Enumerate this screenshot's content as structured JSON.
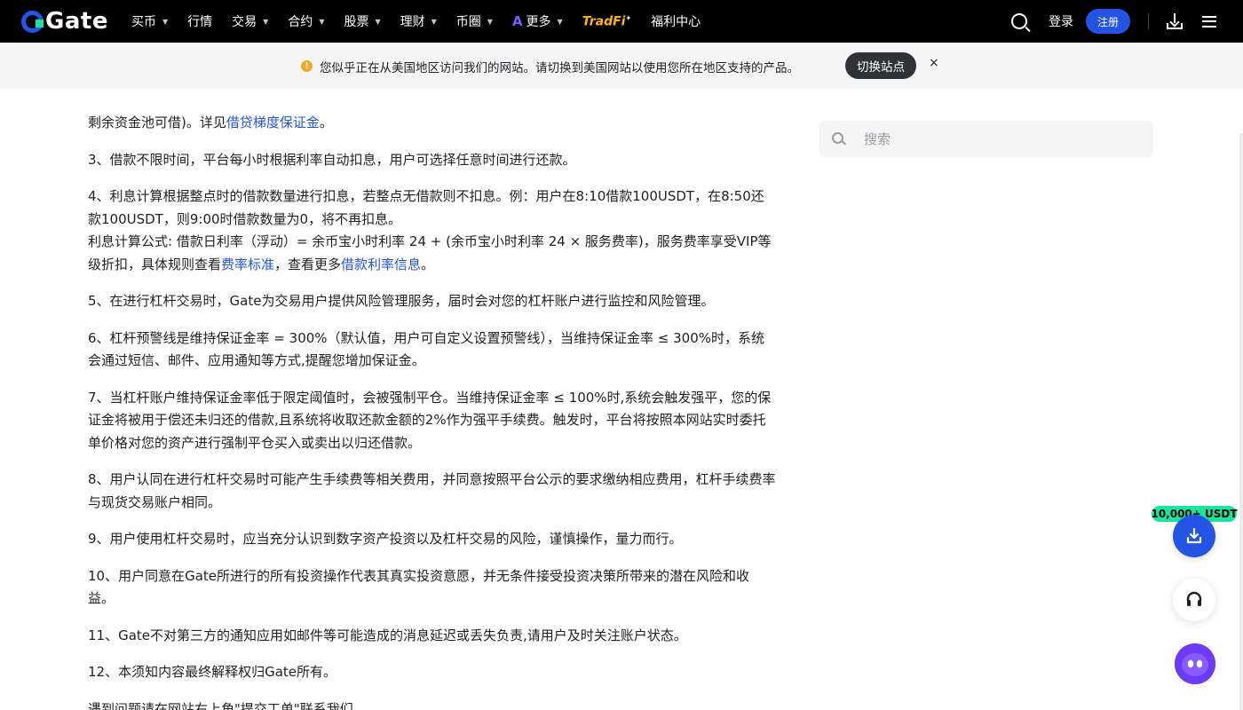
{
  "header": {
    "logo_text": "Gate",
    "nav": [
      {
        "label": "买币",
        "has_caret": true
      },
      {
        "label": "行情",
        "has_caret": false
      },
      {
        "label": "交易",
        "has_caret": true
      },
      {
        "label": "合约",
        "has_caret": true
      },
      {
        "label": "股票",
        "has_caret": true
      },
      {
        "label": "理财",
        "has_caret": true
      },
      {
        "label": "币圈",
        "has_caret": true
      }
    ],
    "more_label": "更多",
    "tradfi_label": "TradFi",
    "welfare_label": "福利中心",
    "login_label": "登录",
    "signup_label": "注册"
  },
  "notice": {
    "message": "您似乎正在从美国地区访问我们的网站。请切换到美国网站以使用您所在地区支持的产品。",
    "switch_label": "切换站点",
    "close_symbol": "×"
  },
  "article": {
    "item2_tail_text": "剩余资金池可借)。详见",
    "item2_link": "借贷梯度保证金",
    "item2_end": "。",
    "item3": "3、借款不限时间，平台每小时根据利率自动扣息，用户可选择任意时间进行还款。",
    "item4_line1": "4、利息计算根据整点时的借款数量进行扣息，若整点无借款则不扣息。例：用户在8:10借款100USDT，在8:50还款100USDT，则9:00时借款数量为0，将不再扣息。",
    "item4_formula": "利息计算公式: 借款日利率（浮动）= 余币宝小时利率 24 + (余币宝小时利率 24 × 服务费率)，服务费率享受VIP等级折扣，具体规则查看",
    "item4_link1": "费率标准",
    "item4_mid": "，查看更多",
    "item4_link2": "借款利率信息",
    "item4_end": "。",
    "item5": "5、在进行杠杆交易时，Gate为交易用户提供风险管理服务，届时会对您的杠杆账户进行监控和风险管理。",
    "item6": "6、杠杆预警线是维持保证金率 = 300%（默认值，用户可自定义设置预警线），当维持保证金率 ≤ 300%时，系统会通过短信、邮件、应用通知等方式,提醒您增加保证金。",
    "item7": "7、当杠杆账户维持保证金率低于限定阈值时，会被强制平仓。当维持保证金率 ≤ 100%时,系统会触发强平，您的保证金将被用于偿还未归还的借款,且系统将收取还款金额的2%作为强平手续费。触发时，平台将按照本网站实时委托单价格对您的资产进行强制平仓买入或卖出以归还借款。",
    "item8": "8、用户认同在进行杠杆交易时可能产生手续费等相关费用，并同意按照平台公示的要求缴纳相应费用，杠杆手续费率与现货交易账户相同。",
    "item9": "9、用户使用杠杆交易时，应当充分认识到数字资产投资以及杠杆交易的风险，谨慎操作，量力而行。",
    "item10": "10、用户同意在Gate所进行的所有投资操作代表其真实投资意愿，并无条件接受投资决策所带来的潜在风险和收益。",
    "item11": "11、Gate不对第三方的通知应用如邮件等可能造成的消息延迟或丢失负责,请用户及时关注账户状态。",
    "item12": "12、本须知内容最终解释权归Gate所有。",
    "footer_partial": "遇到问题请在网站右上角\"提交工单\"联系我们"
  },
  "sidebar": {
    "search_placeholder": "搜索"
  },
  "floating": {
    "promo_label": "10,000+ USDT"
  },
  "colors": {
    "brand_blue": "#2354e6",
    "brand_green": "#17e6a1",
    "header_bg": "#000000",
    "link": "#2354e6"
  }
}
